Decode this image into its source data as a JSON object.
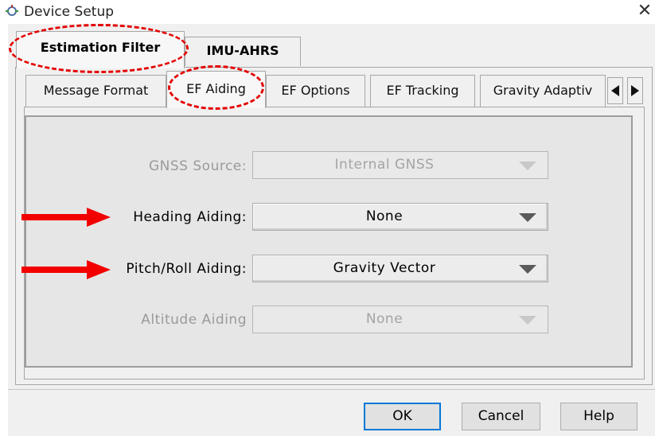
{
  "window": {
    "title": "Device Setup"
  },
  "outer_tabs": [
    {
      "label": "Estimation Filter",
      "active": true
    },
    {
      "label": "IMU-AHRS",
      "active": false
    }
  ],
  "inner_tabs": [
    {
      "label": "Message Format",
      "active": false
    },
    {
      "label": "EF Aiding",
      "active": true
    },
    {
      "label": "EF Options",
      "active": false
    },
    {
      "label": "EF Tracking",
      "active": false
    },
    {
      "label": "Gravity Adaptiv",
      "active": false
    }
  ],
  "fields": [
    {
      "label": "GNSS Source:",
      "value": "Internal GNSS",
      "enabled": false
    },
    {
      "label": "Heading Aiding:",
      "value": "None",
      "enabled": true
    },
    {
      "label": "Pitch/Roll Aiding:",
      "value": "Gravity Vector",
      "enabled": true
    },
    {
      "label": "Altitude Aiding",
      "value": "None",
      "enabled": false
    }
  ],
  "buttons": {
    "ok": "OK",
    "cancel": "Cancel",
    "help": "Help"
  },
  "colors": {
    "highlight_annotation": "#e40000",
    "arrow_annotation": "#f20000",
    "default_button_border": "#0078d7"
  },
  "icons": {
    "app": "device-setup-icon",
    "close": "close-icon",
    "scroll_left": "triangle-left-icon",
    "scroll_right": "triangle-right-icon",
    "dropdown": "chevron-down-icon"
  }
}
